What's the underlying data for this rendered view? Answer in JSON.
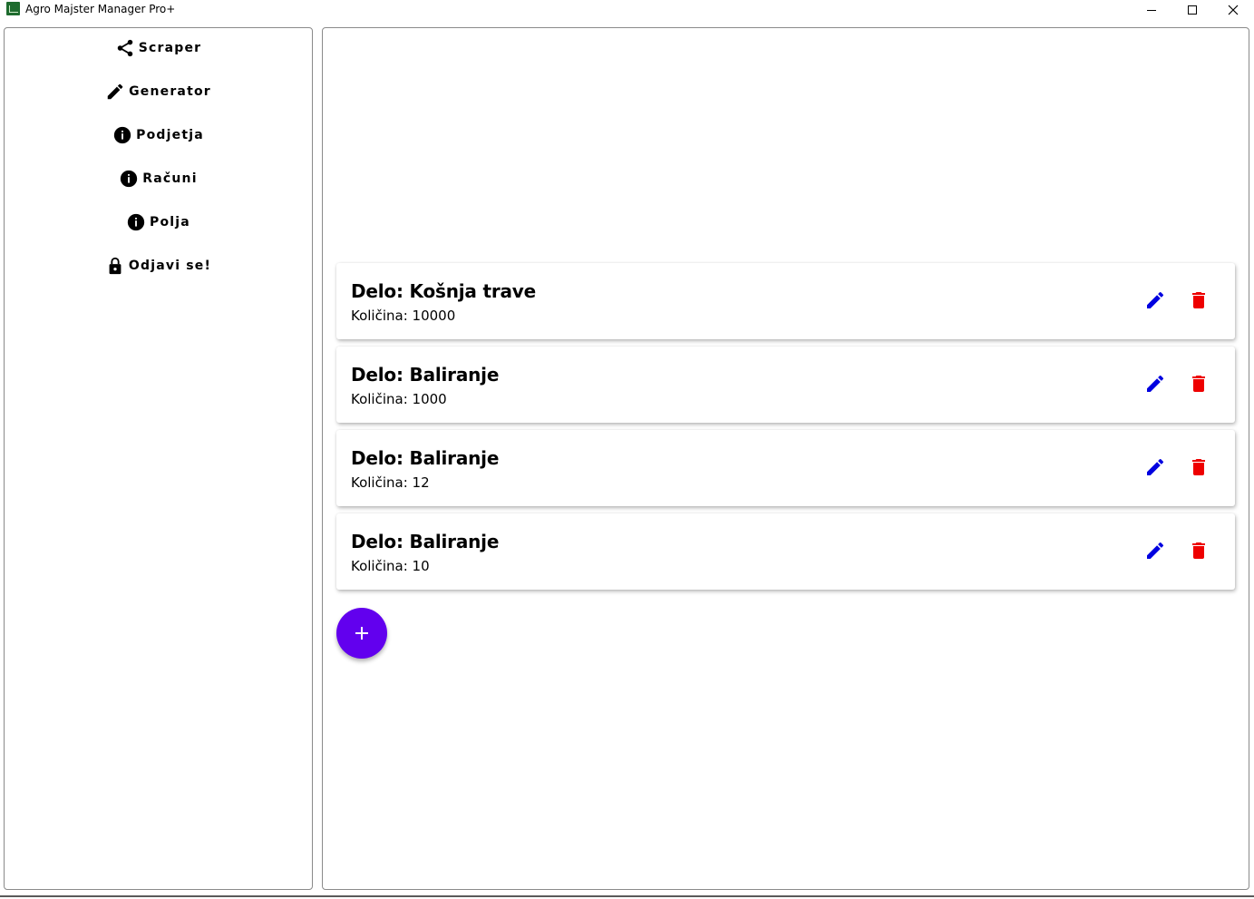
{
  "window": {
    "title": "Agro Majster Manager Pro+",
    "controls": [
      "minimize-icon",
      "maximize-icon",
      "close-icon"
    ]
  },
  "sidebar": {
    "items": [
      {
        "label": "Scraper",
        "icon": "share-icon"
      },
      {
        "label": "Generator",
        "icon": "pencil-icon"
      },
      {
        "label": "Podjetja",
        "icon": "info-icon"
      },
      {
        "label": "Računi",
        "icon": "info-icon"
      },
      {
        "label": "Polja",
        "icon": "info-icon"
      },
      {
        "label": "Odjavi se!",
        "icon": "lock-icon"
      }
    ]
  },
  "main": {
    "cards": [
      {
        "title": "Delo: Košnja trave",
        "subtitle": "Količina: 10000"
      },
      {
        "title": "Delo: Baliranje",
        "subtitle": "Količina: 1000"
      },
      {
        "title": "Delo: Baliranje",
        "subtitle": "Količina: 12"
      },
      {
        "title": "Delo: Baliranje",
        "subtitle": "Količina: 10"
      }
    ],
    "card_actions": {
      "edit_icon": "pencil-icon",
      "delete_icon": "trash-icon"
    },
    "fab": {
      "icon": "plus-icon"
    }
  },
  "colors": {
    "edit": "#0000e0",
    "delete": "#ee0000",
    "fab": "#6200ee",
    "app_icon": "#1e6b2e"
  }
}
